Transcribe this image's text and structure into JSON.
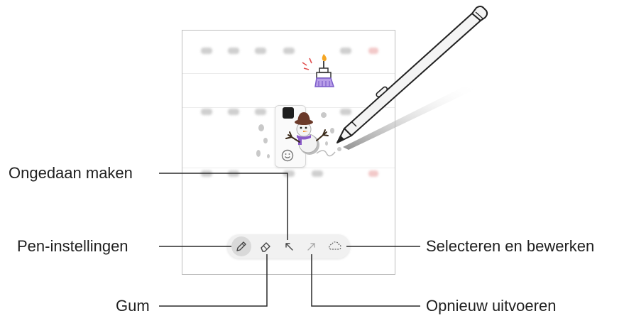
{
  "callouts": {
    "undo": "Ongedaan maken",
    "pen_settings": "Pen-instellingen",
    "eraser": "Gum",
    "select_edit": "Selecteren en bewerken",
    "redo": "Opnieuw uitvoeren"
  },
  "toolbar": {
    "buttons": [
      {
        "icon": "pen-settings-icon",
        "active": true
      },
      {
        "icon": "eraser-icon",
        "active": false
      },
      {
        "icon": "undo-icon",
        "active": false
      },
      {
        "icon": "redo-icon",
        "active": false
      },
      {
        "icon": "lasso-select-icon",
        "active": false
      }
    ]
  },
  "colors": {
    "line": "#2a2a2a",
    "pen_body": "#bfbfbf",
    "candle_flame": "#f5a623",
    "sketch_purple": "#7b5cc9",
    "sketch_red": "#e05050",
    "hat_brown": "#6b3a2a",
    "scarf_purple": "#8a5ac8"
  }
}
